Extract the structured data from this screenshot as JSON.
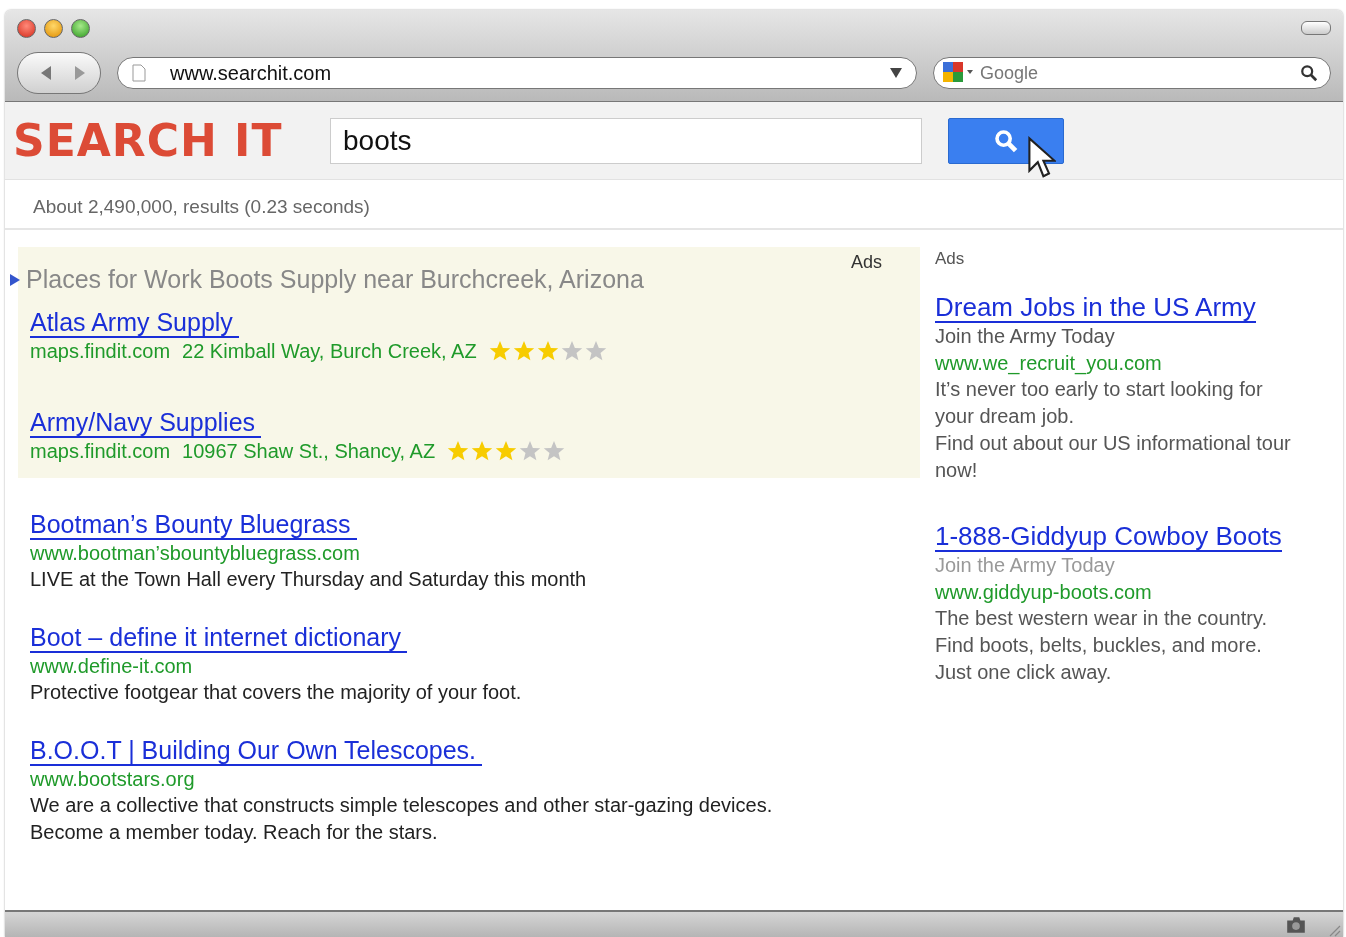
{
  "browser": {
    "address": "www.searchit.com",
    "search_placeholder": "Google"
  },
  "logo": "SEARCH IT",
  "query": "boots",
  "result_stats": "About 2,490,000, results (0.23 seconds)",
  "local_ads": {
    "label": "Ads",
    "heading": "Places for Work Boots Supply near Burchcreek, Arizona",
    "items": [
      {
        "title": "Atlas Army Supply",
        "source": "maps.findit.com",
        "address": "22 Kimball Way, Burch Creek, AZ",
        "stars": 3
      },
      {
        "title": "Army/Navy Supplies",
        "source": "maps.findit.com",
        "address": "10967 Shaw St., Shancy, AZ",
        "stars": 3
      }
    ]
  },
  "results": [
    {
      "title": "Bootman’s Bounty Bluegrass",
      "url": "www.bootman’sbountybluegrass.com",
      "snippet": [
        "LIVE at the Town Hall every Thursday and Saturday this month"
      ]
    },
    {
      "title": "Boot – define it internet dictionary",
      "url": "www.define-it.com",
      "snippet": [
        "Protective footgear that covers the majority of your foot."
      ]
    },
    {
      "title": "B.O.O.T | Building Our Own Telescopes.",
      "url": "www.bootstars.org",
      "snippet": [
        "We are a collective that constructs simple telescopes and other star-gazing devices.",
        "Become a member today. Reach for the stars."
      ]
    }
  ],
  "side_ads": {
    "label": "Ads",
    "items": [
      {
        "title": "Dream Jobs in the US Army",
        "tagline": "Join the Army Today",
        "tagline_dimmed": false,
        "url": "www.we_recruit_you.com",
        "lines": [
          "It’s never too early to start looking for your dream job.",
          "Find out about our US informational tour now!"
        ]
      },
      {
        "title": "1-888-Giddyup Cowboy Boots",
        "tagline": "Join the Army Today",
        "tagline_dimmed": true,
        "url": "www.giddyup-boots.com",
        "lines": [
          "The best western wear in the country.",
          "Find boots, belts, buckles, and more.",
          "Just one click away."
        ]
      }
    ]
  }
}
